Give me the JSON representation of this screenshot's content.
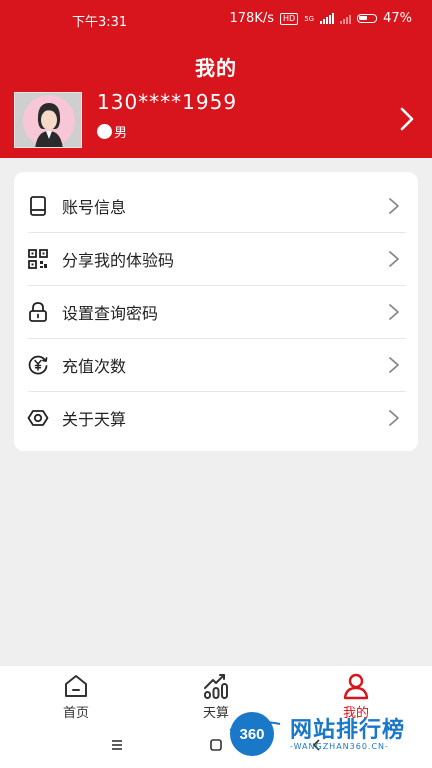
{
  "status_bar": {
    "time": "下午3:31",
    "speed": "178K/s",
    "hd_badge": "HD",
    "network": "5G",
    "battery": "47%"
  },
  "header": {
    "title": "我的",
    "phone": "130****1959",
    "gender": "男"
  },
  "menu": {
    "items": [
      {
        "label": "账号信息",
        "icon": "tablet-icon"
      },
      {
        "label": "分享我的体验码",
        "icon": "qr-code-icon"
      },
      {
        "label": "设置查询密码",
        "icon": "lock-icon"
      },
      {
        "label": "充值次数",
        "icon": "yuan-recharge-icon"
      },
      {
        "label": "关于天算",
        "icon": "eye-hexagon-icon"
      }
    ]
  },
  "tabbar": {
    "tabs": [
      {
        "label": "首页",
        "icon": "home-icon",
        "active": false
      },
      {
        "label": "天算",
        "icon": "chart-icon",
        "active": false
      },
      {
        "label": "我的",
        "icon": "user-icon",
        "active": true
      }
    ],
    "active_color": "#d8141c",
    "inactive_color": "#333333"
  },
  "watermark": {
    "badge": "360",
    "text": "网站排行榜",
    "subtext": "-WANGZHAN360.CN-"
  },
  "colors": {
    "brand": "#d8141c",
    "background": "#efefef",
    "watermark": "#1a78c8"
  }
}
